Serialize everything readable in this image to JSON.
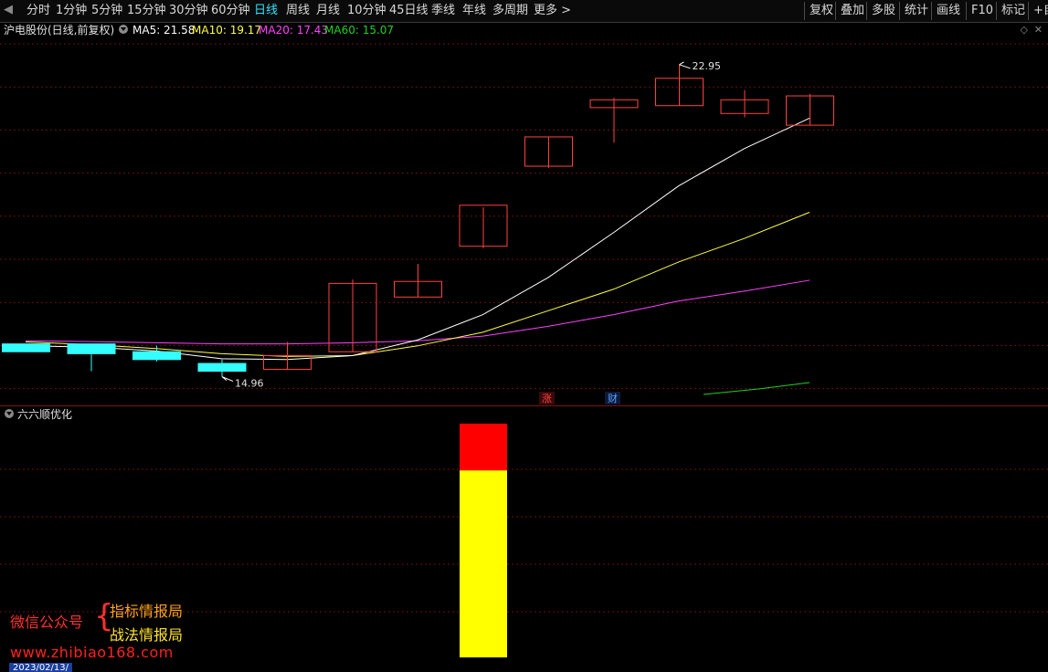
{
  "toolbar": {
    "periods": [
      "分时",
      "1分钟",
      "5分钟",
      "15分钟",
      "30分钟",
      "60分钟",
      "日线",
      "周线",
      "月线",
      "10分钟",
      "45日线",
      "季线",
      "年线",
      "多周期",
      "更多 >"
    ],
    "active_period": "日线",
    "right_items": [
      "复权",
      "叠加",
      "多股",
      "统计",
      "画线",
      "F10",
      "标记",
      "+自"
    ]
  },
  "main_chart": {
    "title": "沪电股份(日线,前复权)",
    "ma_labels": [
      {
        "text": "MA5: 21.58",
        "color": "#ffffff"
      },
      {
        "text": "MA10: 19.17",
        "color": "#ffff40"
      },
      {
        "text": "MA20: 17.43",
        "color": "#ff40ff"
      },
      {
        "text": "MA60: 15.07",
        "color": "#20d020"
      }
    ],
    "high_label": "22.95",
    "low_label": "14.96",
    "badge_zhang": "涨",
    "badge_cai": "财",
    "colors": {
      "up": "#ff4040",
      "down": "#33ffff",
      "ma5": "#ffffff",
      "ma10": "#ffff40",
      "ma20": "#ff40ff",
      "ma60": "#20d020",
      "grid": "#6a1010"
    }
  },
  "chart_data": {
    "type": "candlestick",
    "ylim": [
      14.6,
      23.6
    ],
    "candles": [
      {
        "open": 15.8,
        "high": 15.8,
        "low": 15.6,
        "close": 15.6
      },
      {
        "open": 15.8,
        "high": 15.8,
        "low": 15.1,
        "close": 15.55
      },
      {
        "open": 15.6,
        "high": 15.75,
        "low": 15.35,
        "close": 15.4
      },
      {
        "open": 15.3,
        "high": 15.4,
        "low": 14.96,
        "close": 15.1
      },
      {
        "open": 15.15,
        "high": 15.85,
        "low": 15.15,
        "close": 15.5
      },
      {
        "open": 15.6,
        "high": 17.45,
        "low": 15.6,
        "close": 17.35
      },
      {
        "open": 17.0,
        "high": 17.85,
        "low": 17.0,
        "close": 17.4
      },
      {
        "open": 18.3,
        "high": 19.3,
        "low": 18.25,
        "close": 19.35
      },
      {
        "open": 20.35,
        "high": 21.1,
        "low": 20.3,
        "close": 21.1
      },
      {
        "open": 21.85,
        "high": 22.1,
        "low": 20.95,
        "close": 22.05
      },
      {
        "open": 21.9,
        "high": 22.95,
        "low": 21.9,
        "close": 22.6
      },
      {
        "open": 21.7,
        "high": 22.3,
        "low": 21.6,
        "close": 22.05
      },
      {
        "open": 21.4,
        "high": 22.2,
        "low": 21.4,
        "close": 22.15
      }
    ],
    "ma5": [
      15.75,
      15.72,
      15.62,
      15.42,
      15.4,
      15.5,
      15.9,
      16.55,
      17.5,
      18.65,
      19.85,
      20.8,
      21.58
    ],
    "ma10": [
      15.85,
      15.78,
      15.68,
      15.55,
      15.48,
      15.5,
      15.75,
      16.1,
      16.65,
      17.2,
      17.9,
      18.5,
      19.17
    ],
    "ma20": [
      15.88,
      15.86,
      15.83,
      15.8,
      15.8,
      15.83,
      15.88,
      16.0,
      16.25,
      16.55,
      16.9,
      17.15,
      17.43
    ],
    "ma60": [
      null,
      null,
      null,
      null,
      null,
      null,
      null,
      null,
      null,
      null,
      14.9,
      15.0,
      15.07
    ]
  },
  "sub_chart": {
    "title": "六六顺优化",
    "bar": {
      "total_fraction": 1.0,
      "red_fraction": 0.2,
      "colors": {
        "top": "#ff0000",
        "bottom": "#ffff00"
      }
    }
  },
  "watermark": {
    "line1": "微信公众号",
    "brace": "{",
    "line2": "指标情报局",
    "line3": "战法情报局",
    "url": "www.zhibiao168.com"
  },
  "date_tag": "2023/02/13/"
}
